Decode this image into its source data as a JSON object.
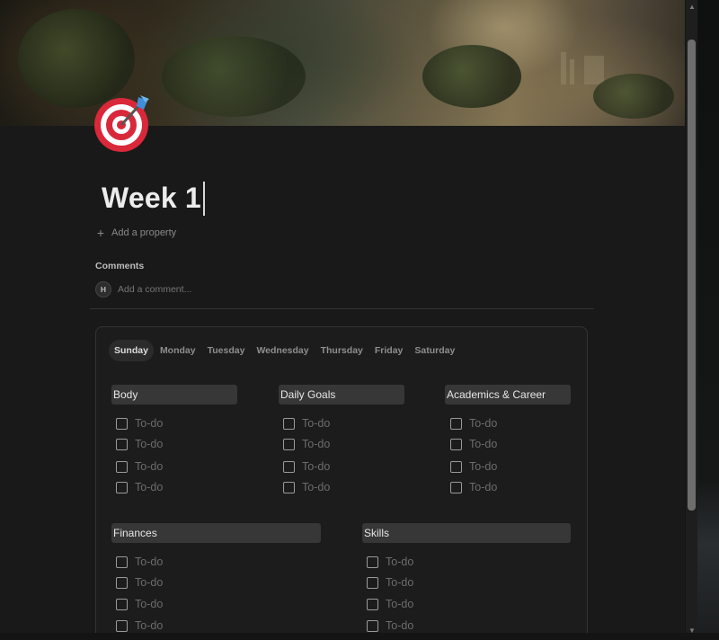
{
  "page": {
    "title": "Week 1",
    "icon": "target-dart-icon",
    "add_property": "Add a property",
    "comments_label": "Comments",
    "avatar_initial": "H",
    "comment_placeholder": "Add a comment..."
  },
  "tabs": {
    "active": "Sunday",
    "items": [
      "Sunday",
      "Monday",
      "Tuesday",
      "Wednesday",
      "Thursday",
      "Friday",
      "Saturday"
    ]
  },
  "sections": [
    {
      "title": "Body",
      "todos": [
        "To-do",
        "To-do",
        "To-do",
        "To-do"
      ]
    },
    {
      "title": "Daily Goals",
      "todos": [
        "To-do",
        "To-do",
        "To-do",
        "To-do"
      ]
    },
    {
      "title": "Academics & Career",
      "todos": [
        "To-do",
        "To-do",
        "To-do",
        "To-do"
      ]
    },
    {
      "title": "Finances",
      "todos": [
        "To-do",
        "To-do",
        "To-do",
        "To-do"
      ]
    },
    {
      "title": "Skills",
      "todos": [
        "To-do",
        "To-do",
        "To-do",
        "To-do"
      ]
    }
  ],
  "colors": {
    "background": "#191919",
    "section_header": "#373737",
    "icon_red": "#d9283a",
    "dart_blue": "#3f8fd6"
  }
}
